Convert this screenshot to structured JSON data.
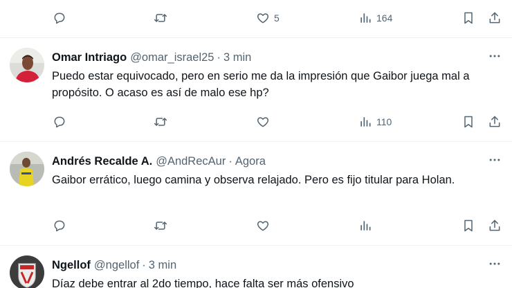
{
  "top_actions": {
    "likes": "5",
    "views": "164"
  },
  "tweets": [
    {
      "name": "Omar Intriago",
      "handle": "@omar_israel25",
      "separator": "·",
      "time": "3 min",
      "text": "Puedo estar equivocado, pero en serio me da la impresión que Gaibor juega mal a propósito. O acaso es así de malo ese hp?",
      "views": "110"
    },
    {
      "name": "Andrés Recalde A.",
      "handle": "@AndRecAur",
      "separator": "·",
      "time": "Agora",
      "text": "Gaibor errático, luego camina y observa relajado. Pero es fijo titular para Holan.",
      "views": ""
    },
    {
      "name": "Ngellof",
      "handle": "@ngellof",
      "separator": "·",
      "time": "3 min",
      "text": "Díaz debe entrar al 2do tiempo, hace falta ser más ofensivo",
      "views": ""
    }
  ],
  "colors": {
    "text": "#0f1419",
    "secondary": "#536471",
    "divider": "#eff3f4"
  },
  "icons": [
    "reply-icon",
    "retweet-icon",
    "like-icon",
    "views-icon",
    "bookmark-icon",
    "share-icon",
    "more-icon"
  ]
}
